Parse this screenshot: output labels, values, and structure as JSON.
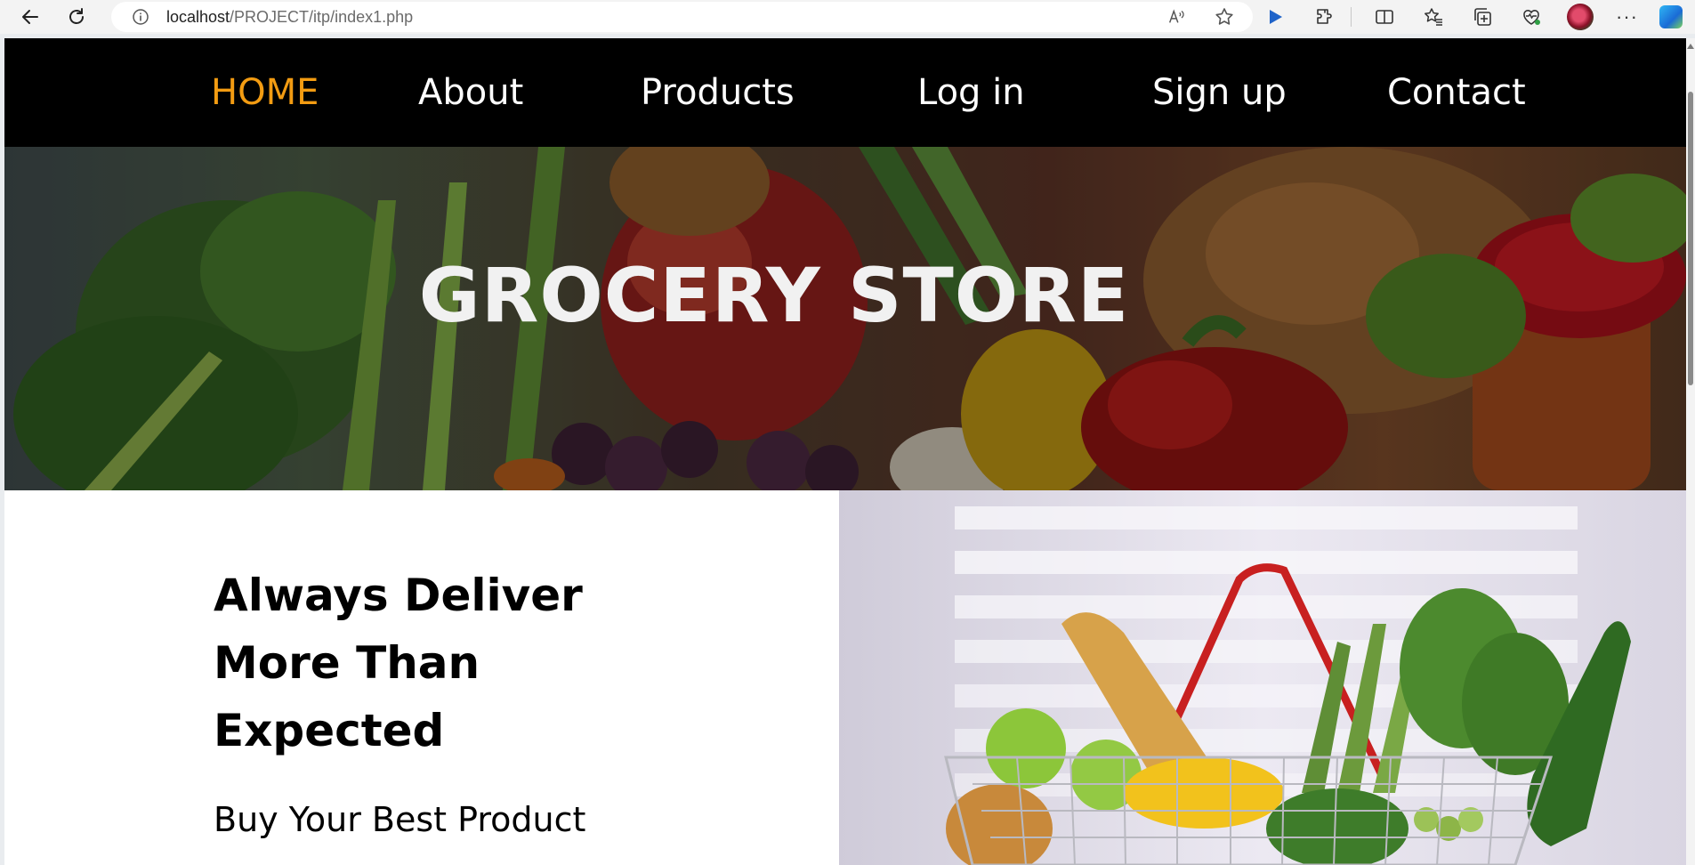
{
  "browser": {
    "url_host": "localhost",
    "url_path": "/PROJECT/itp/index1.php",
    "icons": [
      "back-icon",
      "reload-icon",
      "info-icon",
      "read-aloud-icon",
      "favorite-star-icon",
      "play-icon",
      "extensions-icon",
      "split-screen-icon",
      "favorites-icon",
      "collections-icon",
      "browser-essentials-icon",
      "profile-avatar",
      "more-icon",
      "copilot-icon"
    ],
    "more_label": "···"
  },
  "nav": {
    "items": [
      {
        "label": "HOME",
        "active": true
      },
      {
        "label": "About"
      },
      {
        "label": "Products"
      },
      {
        "label": "Log in"
      },
      {
        "label": "Sign up"
      },
      {
        "label": "Contact"
      }
    ],
    "active_color": "#f39c12"
  },
  "hero": {
    "title": "GROCERY STORE"
  },
  "section": {
    "headline": "Always Deliver More Than Expected",
    "subline": "Buy Your Best Product"
  }
}
